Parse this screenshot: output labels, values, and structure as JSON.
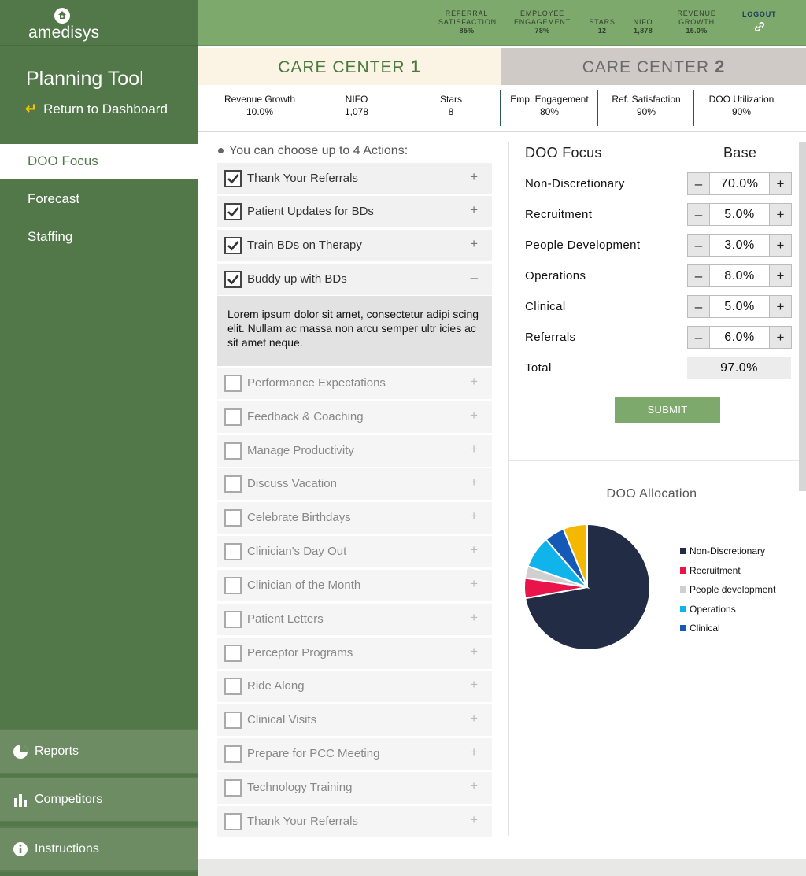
{
  "brand": {
    "name": "amedisys"
  },
  "sidebar": {
    "title": "Planning Tool",
    "return_label": "Return to Dashboard",
    "nav": [
      "DOO Focus",
      "Forecast",
      "Staffing"
    ],
    "bottom": [
      "Reports",
      "Competitors",
      "Instructions"
    ]
  },
  "topbar": {
    "kpis": [
      {
        "label1": "REFERRAL",
        "label2": "SATISFACTION",
        "value": "85%"
      },
      {
        "label1": "EMPLOYEE",
        "label2": "ENGAGEMENT",
        "value": "78%"
      },
      {
        "label1": "",
        "label2": "STARS",
        "value": "12"
      },
      {
        "label1": "",
        "label2": "NIFO",
        "value": "1,878"
      },
      {
        "label1": "REVENUE",
        "label2": "GROWTH",
        "value": "15.0%"
      }
    ],
    "logout": "LOGOUT"
  },
  "tabs": {
    "cc1": {
      "text": "CARE CENTER",
      "num": "1"
    },
    "cc2": {
      "text": "CARE CENTER",
      "num": "2"
    }
  },
  "stats": [
    {
      "label": "Revenue Growth",
      "value": "10.0%"
    },
    {
      "label": "NIFO",
      "value": "1,078"
    },
    {
      "label": "Stars",
      "value": "8"
    },
    {
      "label": "Emp. Engagement",
      "value": "80%"
    },
    {
      "label": "Ref. Satisfaction",
      "value": "90%"
    },
    {
      "label": "DOO Utilization",
      "value": "90%"
    }
  ],
  "actions": {
    "header": "You can choose up to 4 Actions:",
    "items": [
      {
        "label": "Thank Your Referrals",
        "checked": true,
        "toggle": "+"
      },
      {
        "label": "Patient Updates for BDs",
        "checked": true,
        "toggle": "+"
      },
      {
        "label": "Train BDs on Therapy",
        "checked": true,
        "toggle": "+"
      },
      {
        "label": "Buddy up with BDs",
        "checked": true,
        "toggle": "–"
      },
      {
        "label": "Performance Expectations",
        "checked": false,
        "toggle": "+"
      },
      {
        "label": "Feedback & Coaching",
        "checked": false,
        "toggle": "+"
      },
      {
        "label": "Manage Productivity",
        "checked": false,
        "toggle": "+"
      },
      {
        "label": "Discuss Vacation",
        "checked": false,
        "toggle": "+"
      },
      {
        "label": "Celebrate Birthdays",
        "checked": false,
        "toggle": "+"
      },
      {
        "label": "Clinician's Day Out",
        "checked": false,
        "toggle": "+"
      },
      {
        "label": "Clinician of the Month",
        "checked": false,
        "toggle": "+"
      },
      {
        "label": "Patient Letters",
        "checked": false,
        "toggle": "+"
      },
      {
        "label": "Perceptor Programs",
        "checked": false,
        "toggle": "+"
      },
      {
        "label": "Ride Along",
        "checked": false,
        "toggle": "+"
      },
      {
        "label": "Clinical Visits",
        "checked": false,
        "toggle": "+"
      },
      {
        "label": "Prepare for PCC Meeting",
        "checked": false,
        "toggle": "+"
      },
      {
        "label": "Technology Training",
        "checked": false,
        "toggle": "+"
      },
      {
        "label": "Thank Your Referrals",
        "checked": false,
        "toggle": "+"
      }
    ],
    "expanded_description": "Lorem ipsum dolor sit amet, consectetur adipi scing elit. Nullam ac massa non arcu semper ultr icies ac sit amet neque."
  },
  "doo_focus": {
    "title": "DOO Focus",
    "column": "Base",
    "rows": [
      {
        "label": "Non-Discretionary",
        "value": "70.0%"
      },
      {
        "label": "Recruitment",
        "value": "5.0%"
      },
      {
        "label": "People Development",
        "value": "3.0%"
      },
      {
        "label": "Operations",
        "value": "8.0%"
      },
      {
        "label": "Clinical",
        "value": "5.0%"
      },
      {
        "label": "Referrals",
        "value": "6.0%"
      }
    ],
    "total_label": "Total",
    "total_value": "97.0%",
    "submit": "SUBMIT",
    "minus": "–",
    "plus": "+"
  },
  "chart_data": {
    "type": "pie",
    "title": "DOO Allocation",
    "slices": [
      {
        "name": "Non-Discretionary",
        "value": 70,
        "color": "#232c45"
      },
      {
        "name": "Recruitment",
        "value": 5,
        "color": "#e8144a"
      },
      {
        "name": "People development",
        "value": 3,
        "color": "#cfcfcf"
      },
      {
        "name": "Operations",
        "value": 8,
        "color": "#11b4ea"
      },
      {
        "name": "Clinical",
        "value": 5,
        "color": "#1459b5"
      },
      {
        "name": "",
        "value": 6,
        "color": "#f5b800"
      }
    ],
    "legend_position": "right"
  },
  "colors": {
    "sidebar": "#52784a",
    "topbar": "#7da96d",
    "accent_yellow": "#f5c400"
  }
}
